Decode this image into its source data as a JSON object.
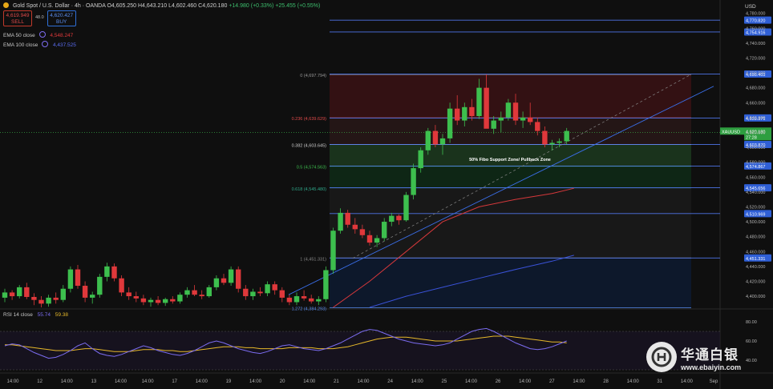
{
  "header": {
    "title": "Gold Spot / U.S. Dollar · 4h · OANDA",
    "ohlc": {
      "open": "O4,605.250",
      "high": "H4,643.210",
      "low": "L4,602.460",
      "close": "C4,620.180",
      "change": "+14.980 (+0.33%)"
    },
    "extra": "+25.455 (+0.55%)"
  },
  "trade": {
    "sell_price": "4,619.949",
    "sell_label": "SELL",
    "spread": "48.0",
    "buy_price": "4,620.427",
    "buy_label": "BUY"
  },
  "indicators": {
    "ema50": {
      "label": "EMA 50 close",
      "value": "4,548.247"
    },
    "ema100": {
      "label": "EMA 100 close",
      "value": "4,437.525"
    },
    "rsi": {
      "label": "RSI 14 close",
      "value1": "55.74",
      "value2": "59.38"
    }
  },
  "currency": "USD",
  "symbol_tag": "XAUUSD",
  "countdown": "27:28",
  "brand": {
    "name": "华通白银",
    "url": "www.ebaiyin.com"
  },
  "colors": {
    "up": "#3dbf4e",
    "down": "#e0383b",
    "ema50": "#d6383b",
    "ema100": "#3a52d8",
    "rsi": "#7b6cf0",
    "rsi_ma": "#e6b82a",
    "hline": "#4f74e8"
  },
  "chart_data": {
    "type": "candlestick",
    "symbol": "XAUUSD",
    "timeframe": "4h",
    "ylim": [
      4385,
      4785
    ],
    "y_ticks": [
      4400,
      4420,
      4440,
      4460,
      4480,
      4500,
      4520,
      4540,
      4560,
      4580,
      4600,
      4620,
      4640,
      4660,
      4680,
      4700,
      4720,
      4740,
      4760,
      4780
    ],
    "y_tick_labels": [
      "4,400.000",
      "4,420.000",
      "4,440.000",
      "4,460.000",
      "4,480.000",
      "4,500.000",
      "4,520.000",
      "4,540.000",
      "4,560.000",
      "4,580.000",
      "4,600.000",
      "4,620.000",
      "4,640.000",
      "4,660.000",
      "4,680.000",
      "4,700.000",
      "4,720.000",
      "4,740.000",
      "4,760.000",
      "4,780.000"
    ],
    "x_labels": [
      "14:00",
      "12",
      "14:00",
      "13",
      "14:00",
      "14:00",
      "17",
      "14:00",
      "19",
      "14:00",
      "20",
      "14:00",
      "21",
      "14:00",
      "24",
      "14:00",
      "25",
      "14:00",
      "26",
      "14:00",
      "27",
      "14:00",
      "28",
      "14:00",
      "31",
      "14:00",
      "Sep"
    ],
    "candles": [
      [
        4398,
        4410,
        4392,
        4405
      ],
      [
        4405,
        4408,
        4395,
        4400
      ],
      [
        4400,
        4415,
        4397,
        4412
      ],
      [
        4412,
        4418,
        4396,
        4399
      ],
      [
        4399,
        4404,
        4388,
        4395
      ],
      [
        4395,
        4400,
        4385,
        4390
      ],
      [
        4390,
        4402,
        4386,
        4398
      ],
      [
        4398,
        4405,
        4390,
        4395
      ],
      [
        4395,
        4415,
        4392,
        4410
      ],
      [
        4410,
        4440,
        4405,
        4436
      ],
      [
        4436,
        4442,
        4410,
        4414
      ],
      [
        4414,
        4420,
        4392,
        4398
      ],
      [
        4398,
        4406,
        4390,
        4402
      ],
      [
        4402,
        4430,
        4398,
        4426
      ],
      [
        4426,
        4445,
        4420,
        4440
      ],
      [
        4440,
        4444,
        4420,
        4424
      ],
      [
        4424,
        4428,
        4400,
        4405
      ],
      [
        4405,
        4412,
        4395,
        4400
      ],
      [
        4400,
        4406,
        4392,
        4397
      ],
      [
        4397,
        4402,
        4388,
        4392
      ],
      [
        4392,
        4398,
        4386,
        4395
      ],
      [
        4395,
        4400,
        4388,
        4391
      ],
      [
        4391,
        4398,
        4387,
        4396
      ],
      [
        4396,
        4400,
        4390,
        4393
      ],
      [
        4393,
        4405,
        4390,
        4402
      ],
      [
        4402,
        4412,
        4398,
        4408
      ],
      [
        4408,
        4415,
        4400,
        4402
      ],
      [
        4402,
        4408,
        4396,
        4400
      ],
      [
        4400,
        4415,
        4398,
        4412
      ],
      [
        4412,
        4428,
        4408,
        4424
      ],
      [
        4424,
        4430,
        4415,
        4418
      ],
      [
        4418,
        4440,
        4414,
        4436
      ],
      [
        4436,
        4440,
        4405,
        4410
      ],
      [
        4410,
        4415,
        4395,
        4400
      ],
      [
        4400,
        4410,
        4395,
        4406
      ],
      [
        4406,
        4412,
        4400,
        4404
      ],
      [
        4404,
        4420,
        4400,
        4416
      ],
      [
        4416,
        4420,
        4402,
        4408
      ],
      [
        4408,
        4412,
        4392,
        4398
      ],
      [
        4398,
        4402,
        4388,
        4392
      ],
      [
        4392,
        4405,
        4388,
        4400
      ],
      [
        4400,
        4408,
        4394,
        4397
      ],
      [
        4397,
        4402,
        4390,
        4393
      ],
      [
        4393,
        4400,
        4388,
        4396
      ],
      [
        4396,
        4440,
        4392,
        4435
      ],
      [
        4435,
        4492,
        4430,
        4488
      ],
      [
        4488,
        4518,
        4484,
        4512
      ],
      [
        4512,
        4516,
        4492,
        4496
      ],
      [
        4496,
        4505,
        4484,
        4490
      ],
      [
        4490,
        4496,
        4478,
        4482
      ],
      [
        4482,
        4488,
        4468,
        4472
      ],
      [
        4472,
        4482,
        4466,
        4478
      ],
      [
        4478,
        4505,
        4474,
        4500
      ],
      [
        4500,
        4512,
        4494,
        4508
      ],
      [
        4508,
        4510,
        4496,
        4502
      ],
      [
        4502,
        4540,
        4500,
        4536
      ],
      [
        4536,
        4578,
        4530,
        4572
      ],
      [
        4572,
        4600,
        4566,
        4596
      ],
      [
        4596,
        4626,
        4590,
        4622
      ],
      [
        4622,
        4630,
        4600,
        4604
      ],
      [
        4604,
        4618,
        4590,
        4612
      ],
      [
        4612,
        4660,
        4606,
        4652
      ],
      [
        4652,
        4670,
        4630,
        4636
      ],
      [
        4636,
        4660,
        4628,
        4654
      ],
      [
        4654,
        4665,
        4636,
        4642
      ],
      [
        4642,
        4692,
        4638,
        4680
      ],
      [
        4680,
        4698,
        4650,
        4625
      ],
      [
        4625,
        4642,
        4618,
        4636
      ],
      [
        4636,
        4648,
        4620,
        4640
      ],
      [
        4640,
        4665,
        4636,
        4660
      ],
      [
        4660,
        4672,
        4630,
        4636
      ],
      [
        4636,
        4648,
        4626,
        4640
      ],
      [
        4640,
        4660,
        4630,
        4634
      ],
      [
        4634,
        4640,
        4616,
        4622
      ],
      [
        4622,
        4628,
        4600,
        4604
      ],
      [
        4604,
        4610,
        4596,
        4606
      ],
      [
        4606,
        4612,
        4600,
        4608
      ],
      [
        4608,
        4626,
        4604,
        4622
      ]
    ],
    "horizontal_levels": [
      {
        "value": 4770.82,
        "label": "4,770.820"
      },
      {
        "value": 4754.916,
        "label": "4,754.916"
      },
      {
        "value": 4698.403,
        "label": "4,698.403"
      },
      {
        "value": 4639.371,
        "label": "4,639.371"
      },
      {
        "value": 4603.87,
        "label": "4,603.870"
      },
      {
        "value": 4574.867,
        "label": "4,574.867"
      },
      {
        "value": 4545.656,
        "label": "4,545.656"
      },
      {
        "value": 4510.969,
        "label": "4,510.969"
      },
      {
        "value": 4451.331,
        "label": "4,451.331"
      }
    ],
    "current_price": {
      "value": 4620.18,
      "label": "4,620.180"
    },
    "fibonacci": [
      {
        "ratio": "0",
        "label": "0 (4,697.794)",
        "value": 4697.794
      },
      {
        "ratio": "0.236",
        "label": "0.236 (4,639.629)",
        "value": 4639.629
      },
      {
        "ratio": "0.382",
        "label": "0.382 (4,603.645)",
        "value": 4603.645
      },
      {
        "ratio": "0.5",
        "label": "0.5 (4,574.563)",
        "value": 4574.563
      },
      {
        "ratio": "0.618",
        "label": "0.618 (4,545.480)",
        "value": 4545.48
      },
      {
        "ratio": "1",
        "label": "1 (4,451.331)",
        "value": 4451.331
      },
      {
        "ratio": "1.272",
        "label": "1.272 (4,384.293)",
        "value": 4384.293
      }
    ],
    "annotation": "50% Fibo Support Zone/ Pullback Zone",
    "ema50_points": [
      [
        45,
        4385
      ],
      [
        50,
        4420
      ],
      [
        55,
        4460
      ],
      [
        60,
        4500
      ],
      [
        65,
        4520
      ],
      [
        70,
        4530
      ],
      [
        75,
        4538
      ],
      [
        78,
        4545
      ]
    ],
    "ema100_points": [
      [
        50,
        4385
      ],
      [
        55,
        4400
      ],
      [
        60,
        4412
      ],
      [
        65,
        4424
      ],
      [
        70,
        4436
      ],
      [
        75,
        4447
      ],
      [
        78,
        4455
      ]
    ],
    "rsi": {
      "ylim": [
        30,
        90
      ],
      "ticks": [
        "80.00",
        "60.00",
        "40.00"
      ],
      "rsi_values": [
        55,
        57,
        56,
        52,
        48,
        45,
        42,
        43,
        46,
        50,
        55,
        58,
        52,
        47,
        45,
        44,
        46,
        49,
        52,
        55,
        53,
        50,
        48,
        46,
        45,
        47,
        50,
        54,
        58,
        60,
        58,
        55,
        52,
        50,
        48,
        47,
        49,
        52,
        55,
        56,
        54,
        52,
        51,
        50,
        52,
        55,
        58,
        62,
        66,
        70,
        72,
        71,
        68,
        65,
        62,
        60,
        58,
        57,
        56,
        55,
        56,
        58,
        62,
        66,
        70,
        72,
        73,
        70,
        66,
        62,
        58,
        55,
        52,
        51,
        52,
        54,
        57,
        60
      ],
      "ma_values": [
        56,
        56,
        55,
        54,
        53,
        52,
        51,
        50,
        50,
        50,
        51,
        52,
        52,
        51,
        50,
        49,
        49,
        49,
        50,
        51,
        51,
        51,
        50,
        50,
        49,
        49,
        50,
        51,
        52,
        53,
        54,
        54,
        54,
        53,
        53,
        52,
        52,
        52,
        52,
        53,
        53,
        53,
        53,
        52,
        52,
        52,
        53,
        54,
        56,
        58,
        60,
        62,
        63,
        64,
        64,
        64,
        63,
        62,
        61,
        60,
        60,
        60,
        60,
        61,
        62,
        63,
        64,
        65,
        65,
        65,
        64,
        63,
        62,
        61,
        60,
        59,
        59,
        58
      ]
    }
  }
}
